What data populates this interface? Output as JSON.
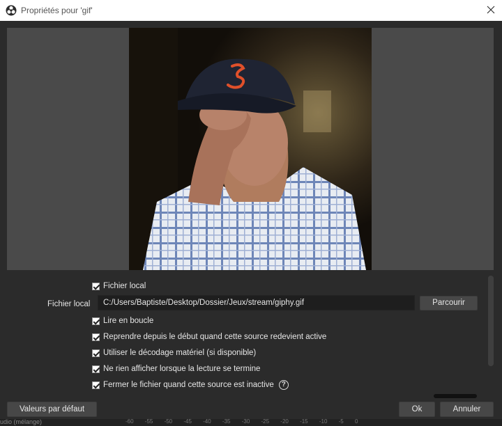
{
  "window": {
    "title": "Propriétés pour 'gif'"
  },
  "preview": {
    "image": "man-in-navy-cap-rubbing-forehead-gif"
  },
  "properties": {
    "local_file_checkbox": {
      "label": "Fichier local",
      "checked": true
    },
    "local_file": {
      "label": "Fichier local",
      "value": "C:/Users/Baptiste/Desktop/Dossier/Jeux/stream/giphy.gif",
      "browse_label": "Parcourir"
    },
    "options": [
      {
        "label": "Lire en boucle",
        "checked": true
      },
      {
        "label": "Reprendre depuis le début quand cette source redevient active",
        "checked": true
      },
      {
        "label": "Utiliser le décodage matériel (si disponible)",
        "checked": true
      },
      {
        "label": "Ne rien afficher lorsque la lecture se termine",
        "checked": true
      },
      {
        "label": "Fermer le fichier quand cette source est inactive",
        "checked": true
      }
    ]
  },
  "footer": {
    "defaults_label": "Valeurs par défaut",
    "ok_label": "Ok",
    "cancel_label": "Annuler"
  },
  "background_strip": {
    "left_text": "udio (mélange)",
    "scale": "-60 -55 -50 -45 -40 -35 -30 -25 -20 -15 -10 -5 0"
  },
  "colors": {
    "window_bg": "#2b2b2b",
    "preview_bg": "#4a4a4a",
    "cap_logo": "#e0502a"
  }
}
